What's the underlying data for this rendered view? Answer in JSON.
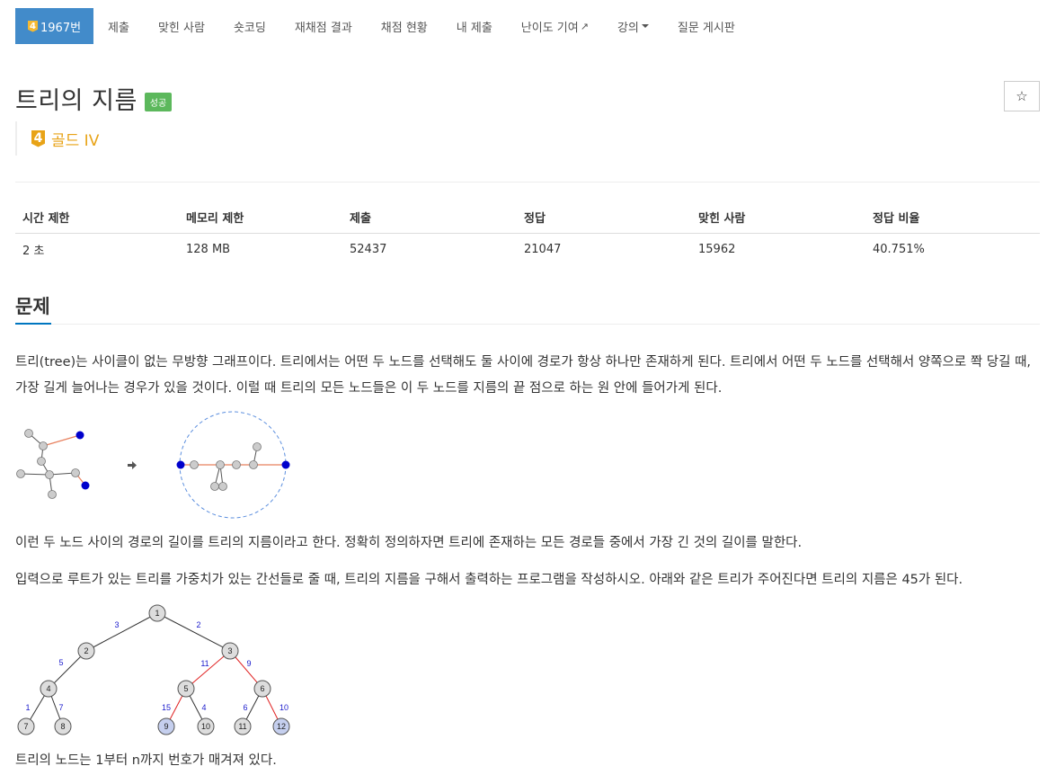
{
  "nav": {
    "tier_number": "4",
    "problem_label": "1967번",
    "items": [
      "제출",
      "맞힌 사람",
      "숏코딩",
      "재채점 결과",
      "채점 현황",
      "내 제출",
      "난이도 기여",
      "강의",
      "질문 게시판"
    ]
  },
  "problem": {
    "title": "트리의 지름",
    "result_label": "성공",
    "tier_number": "4",
    "tier_text": "골드 IV",
    "star_icon": "☆"
  },
  "info_table": {
    "headers": [
      "시간 제한",
      "메모리 제한",
      "제출",
      "정답",
      "맞힌 사람",
      "정답 비율"
    ],
    "values": [
      "2 초",
      "128 MB",
      "52437",
      "21047",
      "15962",
      "40.751%"
    ]
  },
  "section": {
    "heading": "문제",
    "para1": "트리(tree)는 사이클이 없는 무방향 그래프이다. 트리에서는 어떤 두 노드를 선택해도 둘 사이에 경로가 항상 하나만 존재하게 된다. 트리에서 어떤 두 노드를 선택해서 양쪽으로 쫙 당길 때, 가장 길게 늘어나는 경우가 있을 것이다. 이럴 때 트리의 모든 노드들은 이 두 노드를 지름의 끝 점으로 하는 원 안에 들어가게 된다.",
    "para2": "이런 두 노드 사이의 경로의 길이를 트리의 지름이라고 한다. 정확히 정의하자면 트리에 존재하는 모든 경로들 중에서 가장 긴 것의 길이를 말한다.",
    "para3": "입력으로 루트가 있는 트리를 가중치가 있는 간선들로 줄 때, 트리의 지름을 구해서 출력하는 프로그램을 작성하시오. 아래와 같은 트리가 주어진다면 트리의 지름은 45가 된다.",
    "para4": "트리의 노드는 1부터 n까지 번호가 매겨져 있다."
  },
  "weighted_tree": {
    "nodes": [
      "1",
      "2",
      "3",
      "4",
      "5",
      "6",
      "7",
      "8",
      "9",
      "10",
      "11",
      "12"
    ],
    "weights": [
      "3",
      "2",
      "5",
      "11",
      "9",
      "1",
      "7",
      "15",
      "4",
      "6",
      "10"
    ]
  }
}
